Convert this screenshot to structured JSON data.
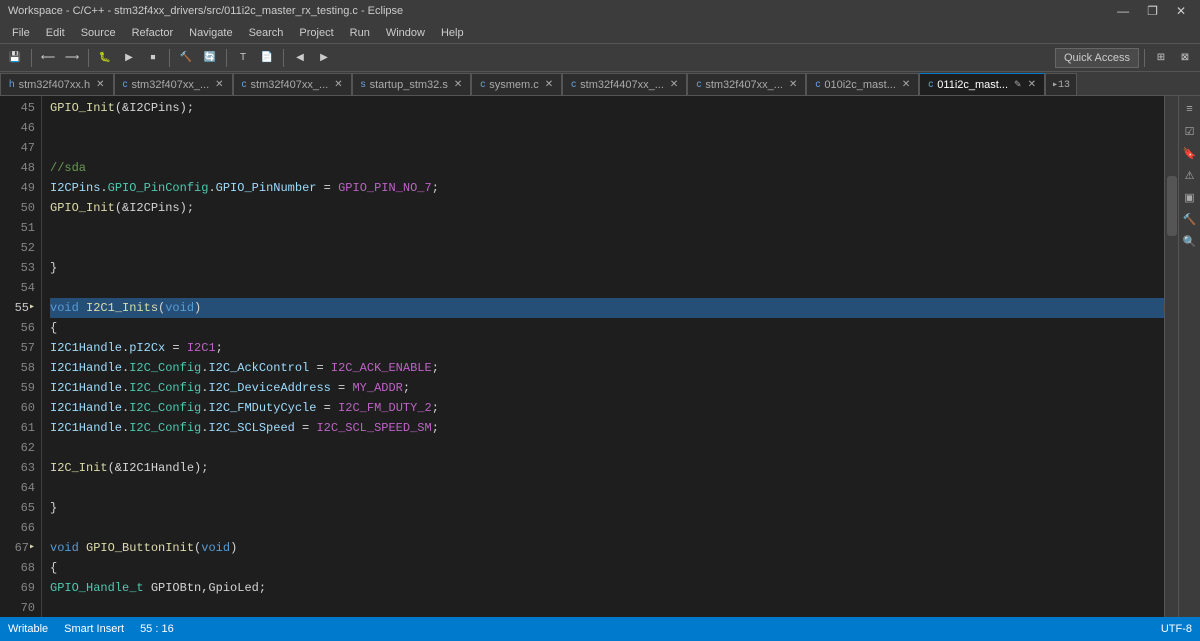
{
  "titleBar": {
    "title": "Workspace - C/C++ - stm32f4xx_drivers/src/011i2c_master_rx_testing.c - Eclipse",
    "controls": [
      "—",
      "❐",
      "✕"
    ]
  },
  "menuBar": {
    "items": [
      "File",
      "Edit",
      "Source",
      "Refactor",
      "Navigate",
      "Search",
      "Project",
      "Run",
      "Window",
      "Help"
    ]
  },
  "toolbar": {
    "quickAccess": "Quick Access"
  },
  "tabs": [
    {
      "label": "stm32f407xx.h",
      "active": false
    },
    {
      "label": "stm32f407xx_...",
      "active": false
    },
    {
      "label": "stm32f407xx_...",
      "active": false
    },
    {
      "label": "startup_stm32.s",
      "active": false
    },
    {
      "label": "sysmem.c",
      "active": false
    },
    {
      "label": "stm32f4407xx_...",
      "active": false
    },
    {
      "label": "stm32f407xx_...",
      "active": false
    },
    {
      "label": "010i2c_mast...",
      "active": false
    },
    {
      "label": "011i2c_mast...",
      "active": true
    }
  ],
  "tabMore": "▸13",
  "code": {
    "startLine": 45,
    "activeLine": 55,
    "lines": [
      {
        "num": 45,
        "content": "    GPIO_Init(&I2CPins);"
      },
      {
        "num": 46,
        "content": ""
      },
      {
        "num": 47,
        "content": ""
      },
      {
        "num": 48,
        "content": "    //sda"
      },
      {
        "num": 49,
        "content": "    I2CPins.GPIO_PinConfig.GPIO_PinNumber = GPIO_PIN_NO_7;"
      },
      {
        "num": 50,
        "content": "    GPIO_Init(&I2CPins);"
      },
      {
        "num": 51,
        "content": ""
      },
      {
        "num": 52,
        "content": ""
      },
      {
        "num": 53,
        "content": "}"
      },
      {
        "num": 54,
        "content": ""
      },
      {
        "num": 55,
        "content": "void I2C1_Inits(void)"
      },
      {
        "num": 56,
        "content": "{"
      },
      {
        "num": 57,
        "content": "    I2C1Handle.pI2Cx = I2C1;"
      },
      {
        "num": 58,
        "content": "    I2C1Handle.I2C_Config.I2C_AckControl = I2C_ACK_ENABLE;"
      },
      {
        "num": 59,
        "content": "    I2C1Handle.I2C_Config.I2C_DeviceAddress = MY_ADDR;"
      },
      {
        "num": 60,
        "content": "    I2C1Handle.I2C_Config.I2C_FMDutyCycle = I2C_FM_DUTY_2;"
      },
      {
        "num": 61,
        "content": "    I2C1Handle.I2C_Config.I2C_SCLSpeed = I2C_SCL_SPEED_SM;"
      },
      {
        "num": 62,
        "content": ""
      },
      {
        "num": 63,
        "content": "    I2C_Init(&I2C1Handle);"
      },
      {
        "num": 64,
        "content": ""
      },
      {
        "num": 65,
        "content": "}"
      },
      {
        "num": 66,
        "content": ""
      },
      {
        "num": 67,
        "content": "void GPIO_ButtonInit(void)"
      },
      {
        "num": 68,
        "content": "{"
      },
      {
        "num": 69,
        "content": "    GPIO_Handle_t GPIOBtn,GpioLed;"
      },
      {
        "num": 70,
        "content": ""
      }
    ]
  },
  "statusBar": {
    "writable": "Writable",
    "insertMode": "Smart Insert",
    "position": "55 : 16",
    "encoding": "UTF-8"
  }
}
